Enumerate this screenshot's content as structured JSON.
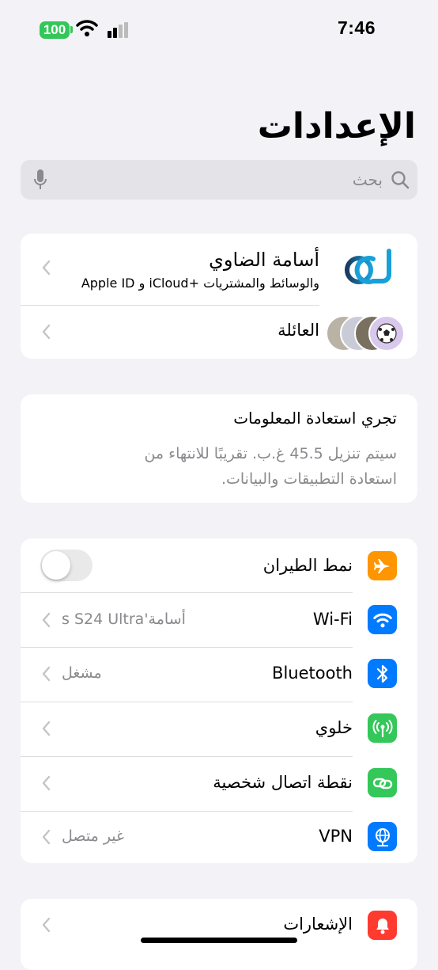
{
  "status_bar": {
    "battery": "100",
    "time": "7:46"
  },
  "title": "الإعدادات",
  "search": {
    "placeholder": "بحث"
  },
  "profile": {
    "name": "أسامة الضاوي",
    "subtitle": "Apple ID و iCloud+ والوسائط والمشتريات",
    "family_label": "العائلة"
  },
  "restore": {
    "title": "تجري استعادة المعلومات",
    "line1": "سيتم تنزيل 45.5 غ.ب. تقريبًا للانتهاء من",
    "line2": "استعادة التطبيقات والبيانات."
  },
  "settings": {
    "airplane": {
      "label": "نمط الطيران",
      "enabled": false,
      "icon": "airplane-icon",
      "color": "#ff9500"
    },
    "wifi": {
      "label": "Wi-Fi",
      "value": "أسامة's S24 Ultra",
      "icon": "wifi-icon",
      "color": "#007aff"
    },
    "bluetooth": {
      "label": "Bluetooth",
      "value": "مشغل",
      "icon": "bluetooth-icon",
      "color": "#007aff"
    },
    "cellular": {
      "label": "خلوي",
      "icon": "antenna-icon",
      "color": "#34c759"
    },
    "hotspot": {
      "label": "نقطة اتصال شخصية",
      "icon": "link-icon",
      "color": "#34c759"
    },
    "vpn": {
      "label": "VPN",
      "value": "غير متصل",
      "icon": "globe-icon",
      "color": "#007aff"
    }
  },
  "notifications": {
    "label": "الإشعارات",
    "icon": "bell-icon",
    "color": "#ff3b30"
  }
}
